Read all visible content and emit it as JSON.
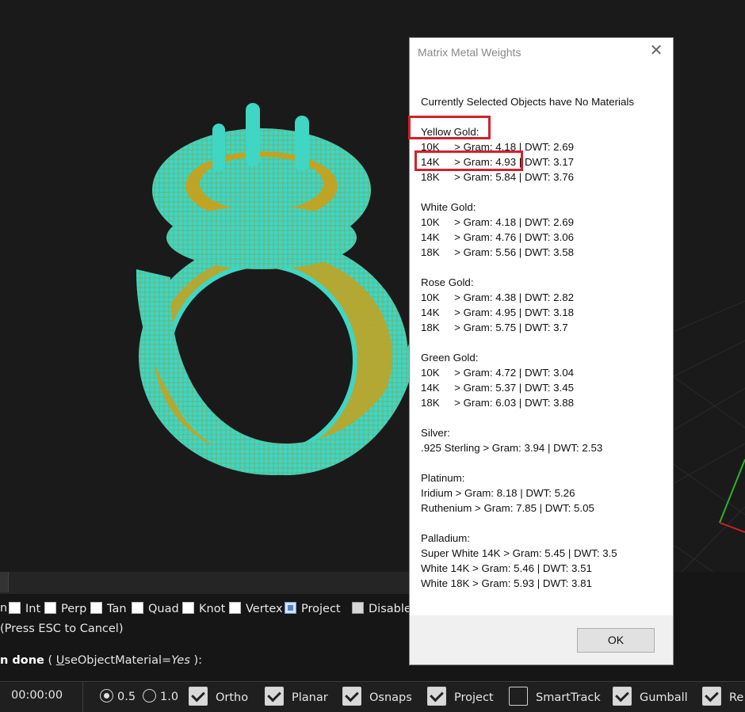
{
  "dialog": {
    "title": "Matrix Metal Weights",
    "close_glyph": "✕",
    "ok_label": "OK",
    "intro": "Currently Selected Objects have No Materials",
    "groups": [
      {
        "name": "Yellow Gold:",
        "rows": [
          "10K     > Gram: 4.18 | DWT: 2.69",
          "14K     > Gram: 4.93 | DWT: 3.17",
          "18K     > Gram: 5.84 | DWT: 3.76"
        ]
      },
      {
        "name": "White Gold:",
        "rows": [
          "10K     > Gram: 4.18 | DWT: 2.69",
          "14K     > Gram: 4.76 | DWT: 3.06",
          "18K     > Gram: 5.56 | DWT: 3.58"
        ]
      },
      {
        "name": "Rose Gold:",
        "rows": [
          "10K     > Gram: 4.38 | DWT: 2.82",
          "14K     > Gram: 4.95 | DWT: 3.18",
          "18K     > Gram: 5.75 | DWT: 3.7"
        ]
      },
      {
        "name": "Green Gold:",
        "rows": [
          "10K     > Gram: 4.72 | DWT: 3.04",
          "14K     > Gram: 5.37 | DWT: 3.45",
          "18K     > Gram: 6.03 | DWT: 3.88"
        ]
      },
      {
        "name": "Silver:",
        "rows": [
          ".925 Sterling > Gram: 3.94 | DWT: 2.53"
        ]
      },
      {
        "name": "Platinum:",
        "rows": [
          "Iridium > Gram: 8.18 | DWT: 5.26",
          "Ruthenium > Gram: 7.85 | DWT: 5.05"
        ]
      },
      {
        "name": "Palladium:",
        "rows": [
          "Super White 14K > Gram: 5.45 | DWT: 3.5",
          "White 14K > Gram: 5.46 | DWT: 3.51",
          "White 18K > Gram: 5.93 | DWT: 3.81"
        ]
      }
    ]
  },
  "osnaps": [
    {
      "label": "n",
      "state": "none"
    },
    {
      "label": "Int",
      "state": "off"
    },
    {
      "label": "Perp",
      "state": "off"
    },
    {
      "label": "Tan",
      "state": "off"
    },
    {
      "label": "Quad",
      "state": "off"
    },
    {
      "label": "Knot",
      "state": "off"
    },
    {
      "label": "Vertex",
      "state": "off"
    },
    {
      "label": "Project",
      "state": "on"
    },
    {
      "label": "Disable",
      "state": "disabled"
    }
  ],
  "command": {
    "history": "(Press ESC to Cancel)",
    "prompt_bold": "n done",
    "prompt_open": " ( ",
    "option_underlined": "U",
    "option_rest": "seObjectMaterial",
    "option_eq": "=",
    "option_value": "Yes",
    "prompt_close": " ):"
  },
  "statusbar": {
    "timer": "00:00:00",
    "radio_a": "0.5",
    "radio_b": "1.0",
    "toggles": [
      {
        "label": "Ortho",
        "checked": true
      },
      {
        "label": "Planar",
        "checked": true
      },
      {
        "label": "Osnaps",
        "checked": true
      },
      {
        "label": "Project",
        "checked": true
      },
      {
        "label": "SmartTrack",
        "checked": false
      },
      {
        "label": "Gumball",
        "checked": true
      },
      {
        "label": "Re",
        "checked": true
      }
    ]
  },
  "colors": {
    "highlight": "#d3202c",
    "ring_mesh": "#3fd6c4",
    "ring_gold": "#c9a018",
    "background": "#1a1a1a"
  }
}
